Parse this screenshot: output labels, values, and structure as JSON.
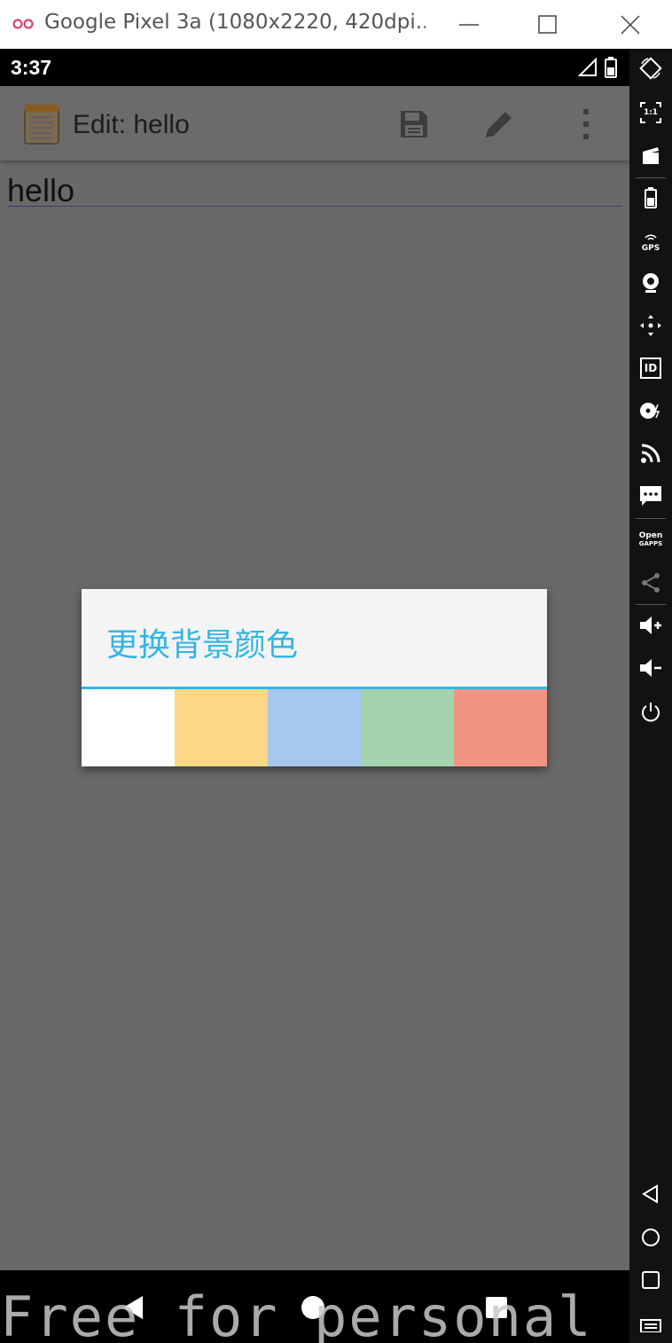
{
  "window": {
    "title": "Google Pixel 3a (1080x2220, 420dpi...",
    "logo_icon": "genymotion-logo-icon",
    "minimize_icon": "minimize-icon",
    "maximize_icon": "maximize-icon",
    "close_icon": "close-icon"
  },
  "status_bar": {
    "time": "3:37",
    "icons": [
      "signal-icon",
      "battery-icon"
    ]
  },
  "app_bar": {
    "title": "Edit: hello",
    "app_icon": "notepad-icon",
    "actions": [
      "save-icon",
      "edit-icon",
      "more-vert-icon"
    ]
  },
  "editor": {
    "text": "hello"
  },
  "dialog": {
    "title": "更换背景颜色",
    "accent_color": "#33b5e5",
    "swatches": [
      {
        "name": "white",
        "color": "#ffffff"
      },
      {
        "name": "yellow",
        "color": "#fdd886"
      },
      {
        "name": "blue",
        "color": "#a5c8ec"
      },
      {
        "name": "green",
        "color": "#a3d4ae"
      },
      {
        "name": "red",
        "color": "#f29484"
      }
    ]
  },
  "nav_bar": {
    "buttons": [
      "back-icon",
      "home-icon",
      "recents-icon"
    ]
  },
  "watermark": "Free for personal use",
  "side_panel": {
    "tools": [
      "rotate-icon",
      "pixel-perfect-icon",
      "capture-icon",
      "battery-icon",
      "gps-icon",
      "camera-icon",
      "dpad-icon",
      "device-id-icon",
      "disk-io-icon",
      "network-icon",
      "sms-icon",
      "open-gapps-icon",
      "share-icon",
      "volume-up-icon",
      "volume-down-icon",
      "power-icon",
      "back-icon",
      "home-icon",
      "recents-icon",
      "menu-icon"
    ],
    "gps_label": "GPS",
    "gapps_label_1": "Open",
    "gapps_label_2": "GAPPS",
    "pixel_label": "1:1",
    "id_label": "ID"
  }
}
